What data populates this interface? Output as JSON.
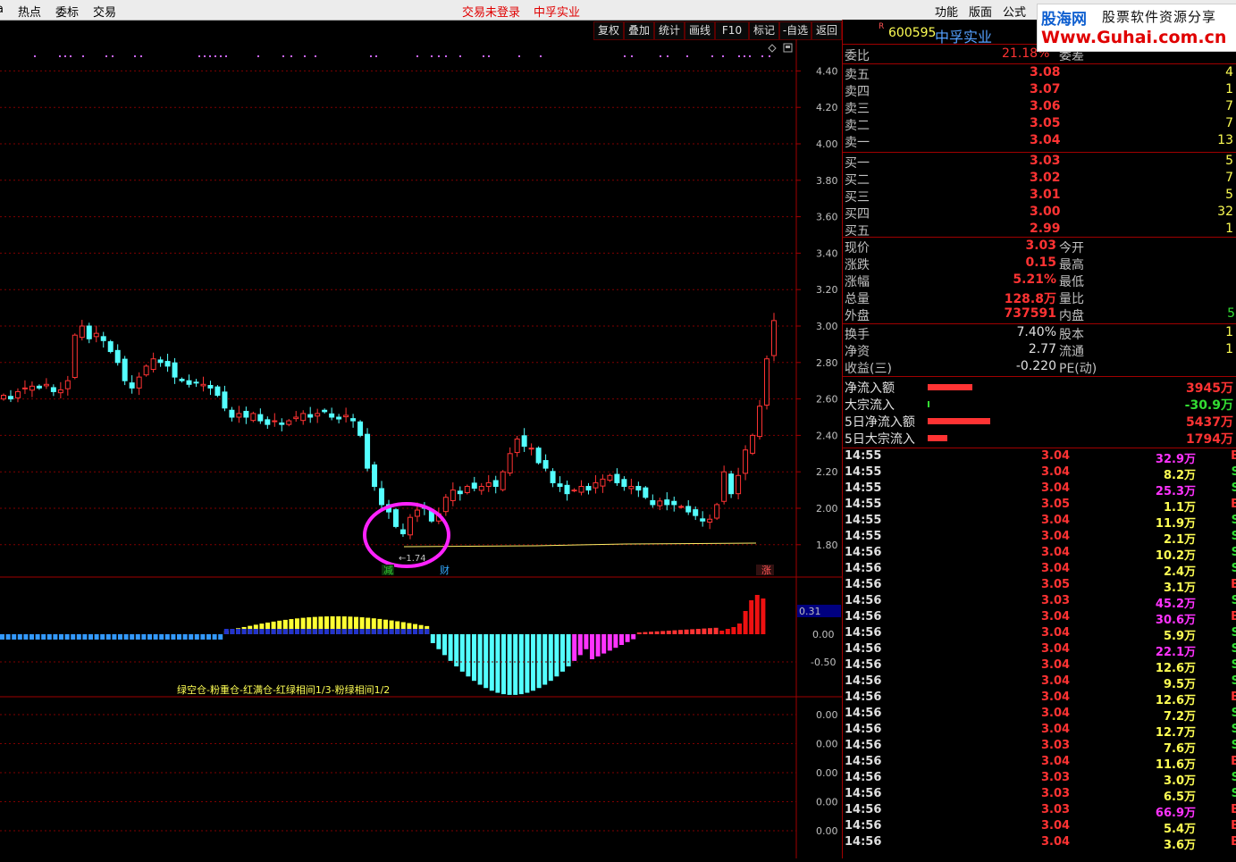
{
  "menubar": {
    "items": [
      "热点",
      "委标",
      "交易"
    ],
    "login_status": "交易未登录",
    "stock_title": "中孚实业",
    "right_items": [
      "功能",
      "版面",
      "公式"
    ]
  },
  "logo": {
    "name": "股海网",
    "slogan": "股票软件资源分享",
    "url": "Www.Guhai.com.cn"
  },
  "toolbar": {
    "buttons": [
      "复权",
      "叠加",
      "统计",
      "画线",
      "F10",
      "标记",
      "-自选",
      "返回"
    ]
  },
  "price_axis": {
    "labels": [
      "4.40",
      "4.20",
      "4.00",
      "3.80",
      "3.60",
      "3.40",
      "3.20",
      "3.00",
      "2.80",
      "2.60",
      "2.40",
      "2.20",
      "2.00",
      "1.80"
    ]
  },
  "main_chart": {
    "low_marker": "←1.74",
    "markers": [
      {
        "label": "减",
        "color": "#33cc33"
      },
      {
        "label": "财",
        "color": "#33aaff"
      },
      {
        "label": "涨",
        "color": "#ff5555"
      }
    ]
  },
  "indicator": {
    "axis_labels": [
      "0.00",
      "-0.50"
    ],
    "value_box": "0.31",
    "legend": "绿空仓-粉重仓-红满仓-红绿相间1/3-粉绿相间1/2"
  },
  "lower_axis": {
    "labels": [
      "0.00",
      "0.00",
      "0.00",
      "0.00",
      "0.00"
    ]
  },
  "quote": {
    "r_badge": "R",
    "code": "600595",
    "name": "中孚实业",
    "weibi_label": "委比",
    "weibi_value": "21.18%",
    "weicha_label": "委差",
    "sell": [
      {
        "label": "卖五",
        "price": "3.08",
        "vol": "4"
      },
      {
        "label": "卖四",
        "price": "3.07",
        "vol": "1"
      },
      {
        "label": "卖三",
        "price": "3.06",
        "vol": "7"
      },
      {
        "label": "卖二",
        "price": "3.05",
        "vol": "7"
      },
      {
        "label": "卖一",
        "price": "3.04",
        "vol": "13"
      }
    ],
    "buy": [
      {
        "label": "买一",
        "price": "3.03",
        "vol": "5"
      },
      {
        "label": "买二",
        "price": "3.02",
        "vol": "7"
      },
      {
        "label": "买三",
        "price": "3.01",
        "vol": "5"
      },
      {
        "label": "买四",
        "price": "3.00",
        "vol": "32"
      },
      {
        "label": "买五",
        "price": "2.99",
        "vol": "1"
      }
    ],
    "stats1": [
      {
        "label": "现价",
        "value": "3.03",
        "label2": "今开"
      },
      {
        "label": "涨跌",
        "value": "0.15",
        "label2": "最高"
      },
      {
        "label": "涨幅",
        "value": "5.21%",
        "label2": "最低"
      },
      {
        "label": "总量",
        "value": "128.8万",
        "label2": "量比"
      },
      {
        "label": "外盘",
        "value": "737591",
        "label2": "内盘",
        "value2": "5"
      }
    ],
    "stats2": [
      {
        "label": "换手",
        "value": "7.40%",
        "label2": "股本",
        "value2": "1"
      },
      {
        "label": "净资",
        "value": "2.77",
        "label2": "流通",
        "value2": "1"
      },
      {
        "label": "收益(三)",
        "value": "-0.220",
        "label2": "PE(动)"
      }
    ],
    "flows": [
      {
        "label": "净流入额",
        "value": "3945万",
        "color": "#ff3333",
        "bar": 50
      },
      {
        "label": "大宗流入",
        "value": "-30.9万",
        "color": "#33dd33",
        "bar": 2
      },
      {
        "label": "5日净流入额",
        "value": "5437万",
        "color": "#ff3333",
        "bar": 70
      },
      {
        "label": "5日大宗流入",
        "value": "1794万",
        "color": "#ff3333",
        "bar": 22
      }
    ]
  },
  "ticks": [
    {
      "time": "14:55",
      "price": "3.04",
      "vol": "32.9万",
      "side": "B",
      "big": true
    },
    {
      "time": "14:55",
      "price": "3.04",
      "vol": "8.2万",
      "side": "S"
    },
    {
      "time": "14:55",
      "price": "3.04",
      "vol": "25.3万",
      "side": "S",
      "big": true
    },
    {
      "time": "14:55",
      "price": "3.05",
      "vol": "1.1万",
      "side": "B"
    },
    {
      "time": "14:55",
      "price": "3.04",
      "vol": "11.9万",
      "side": "S"
    },
    {
      "time": "14:55",
      "price": "3.04",
      "vol": "2.1万",
      "side": "S"
    },
    {
      "time": "14:56",
      "price": "3.04",
      "vol": "10.2万",
      "side": "S"
    },
    {
      "time": "14:56",
      "price": "3.04",
      "vol": "2.4万",
      "side": "S"
    },
    {
      "time": "14:56",
      "price": "3.05",
      "vol": "3.1万",
      "side": "B"
    },
    {
      "time": "14:56",
      "price": "3.03",
      "vol": "45.2万",
      "side": "S",
      "big": true
    },
    {
      "time": "14:56",
      "price": "3.04",
      "vol": "30.6万",
      "side": "B",
      "big": true
    },
    {
      "time": "14:56",
      "price": "3.04",
      "vol": "5.9万",
      "side": "S"
    },
    {
      "time": "14:56",
      "price": "3.04",
      "vol": "22.1万",
      "side": "S",
      "big": true
    },
    {
      "time": "14:56",
      "price": "3.04",
      "vol": "12.6万",
      "side": "S"
    },
    {
      "time": "14:56",
      "price": "3.04",
      "vol": "9.5万",
      "side": "S"
    },
    {
      "time": "14:56",
      "price": "3.04",
      "vol": "12.6万",
      "side": "B"
    },
    {
      "time": "14:56",
      "price": "3.04",
      "vol": "7.2万",
      "side": "S"
    },
    {
      "time": "14:56",
      "price": "3.04",
      "vol": "12.7万",
      "side": "S"
    },
    {
      "time": "14:56",
      "price": "3.03",
      "vol": "7.6万",
      "side": "S"
    },
    {
      "time": "14:56",
      "price": "3.04",
      "vol": "11.6万",
      "side": "B"
    },
    {
      "time": "14:56",
      "price": "3.03",
      "vol": "3.0万",
      "side": "S"
    },
    {
      "time": "14:56",
      "price": "3.03",
      "vol": "6.5万",
      "side": "S"
    },
    {
      "time": "14:56",
      "price": "3.03",
      "vol": "66.9万",
      "side": "B",
      "big": true
    },
    {
      "time": "14:56",
      "price": "3.04",
      "vol": "5.4万",
      "side": "B"
    },
    {
      "time": "14:56",
      "price": "3.04",
      "vol": "3.6万",
      "side": "B"
    }
  ],
  "colors": {
    "up": "#ff3333",
    "down": "#54ffff",
    "grid": "#800000",
    "text": "#c0c0c0",
    "accent": "#ffff54",
    "magenta": "#ff33ff"
  }
}
